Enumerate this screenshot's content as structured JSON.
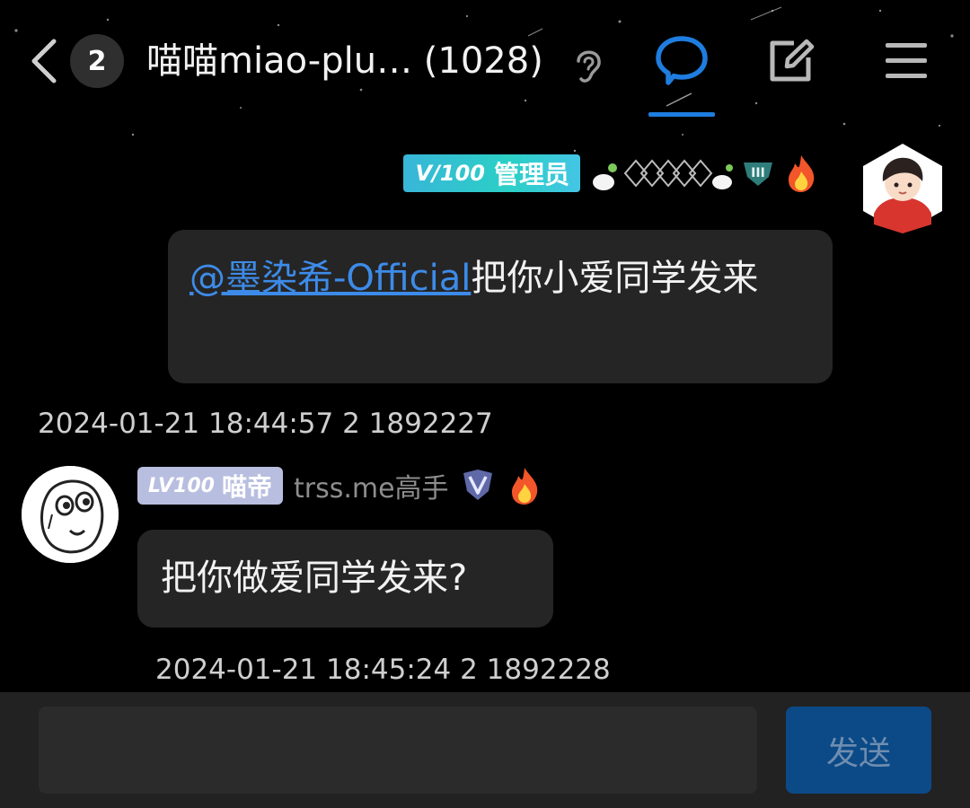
{
  "header": {
    "back_icon": "chevron-left-icon",
    "unread_count": "2",
    "title": "喵喵miao-plu… (1028)",
    "ear_icon": "ear-icon",
    "tabs": [
      {
        "icon": "chat-bubble-icon",
        "active": true
      },
      {
        "icon": "edit-icon",
        "active": false
      },
      {
        "icon": "menu-icon",
        "active": false
      }
    ]
  },
  "messages": [
    {
      "side": "right",
      "level_badge": "V/100",
      "role_badge": "管理员",
      "nickname_visual": "pixel-pattern-decoration",
      "rank_icon": "rank-iii-icon",
      "fire_icon": "fire-icon",
      "avatar": "cartoon-boy-avatar",
      "mention": "@墨染希-Official",
      "text": "把你小爱同学发来",
      "meta": "2024-01-21 18:44:57 2 1892227"
    },
    {
      "side": "left",
      "level_badge": "LV100",
      "role_badge": "喵帝",
      "nickname": "trss.me高手",
      "rank_icon": "shield-v-icon",
      "fire_icon": "fire-icon",
      "avatar": "meme-face-avatar",
      "text": "把你做爱同学发来?",
      "meta": "2024-01-21 18:45:24 2 1892228"
    }
  ],
  "composer": {
    "placeholder": "",
    "send_label": "发送"
  },
  "colors": {
    "background": "#000000",
    "bubble": "#252525",
    "accent": "#1e7ddf",
    "mention": "#3d8be8",
    "send_button": "#0b4a87",
    "composer_bar": "#222222"
  }
}
